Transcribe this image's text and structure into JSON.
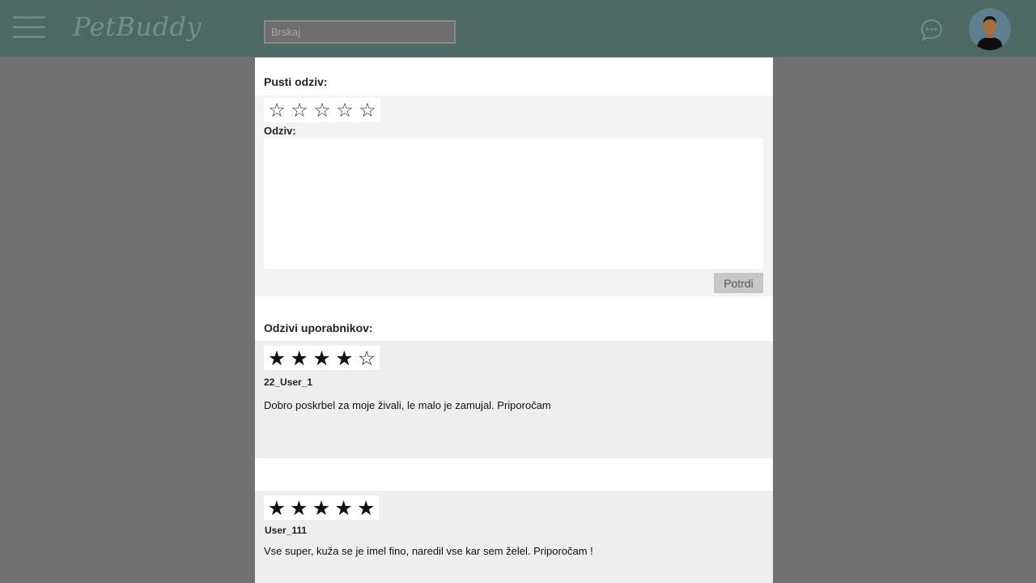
{
  "header": {
    "logo_text": "PetBuddy",
    "search_placeholder": "Brskaj",
    "menu_icon": "hamburger-menu-icon",
    "chat_icon": "chat-bubble-icon",
    "colors": {
      "bar": "#4e6864",
      "overlay": "#717171"
    }
  },
  "leave_review": {
    "title": "Pusti odziv:",
    "rating_label": "",
    "empty_star": "☆",
    "review_label": "Odziv:",
    "review_value": "",
    "submit_label": "Potrdi"
  },
  "user_reviews": {
    "title": "Odzivi uporabnikov:",
    "items": [
      {
        "rating": 4,
        "max_rating": 5,
        "stars": [
          "★",
          "★",
          "★",
          "★",
          "☆"
        ],
        "user": "22_User_1",
        "text": "Dobro poskrbel za moje živali, le malo je zamujal. Priporočam"
      },
      {
        "rating": 5,
        "max_rating": 5,
        "stars": [
          "★",
          "★",
          "★",
          "★",
          "★"
        ],
        "user": "User_111",
        "text": "Vse super, kuža se je imel fino, naredil vse kar sem želel. Priporočam !"
      }
    ]
  }
}
